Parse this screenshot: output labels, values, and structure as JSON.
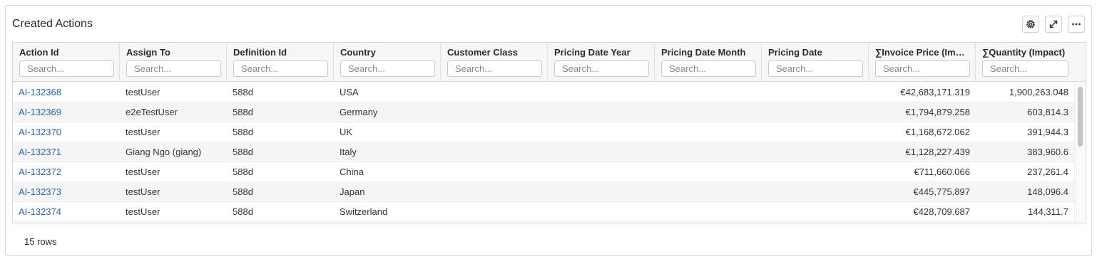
{
  "panel": {
    "title": "Created Actions",
    "tools": [
      {
        "icon": "gear-icon"
      },
      {
        "icon": "expand-icon"
      },
      {
        "icon": "more-icon"
      }
    ]
  },
  "table": {
    "columns": [
      {
        "label": "Action Id",
        "placeholder": "Search..."
      },
      {
        "label": "Assign To",
        "placeholder": "Search..."
      },
      {
        "label": "Definition Id",
        "placeholder": "Search..."
      },
      {
        "label": "Country",
        "placeholder": "Search..."
      },
      {
        "label": "Customer Class",
        "placeholder": "Search..."
      },
      {
        "label": "Pricing Date Year",
        "placeholder": "Search..."
      },
      {
        "label": "Pricing Date Month",
        "placeholder": "Search..."
      },
      {
        "label": "Pricing Date",
        "placeholder": "Search..."
      },
      {
        "label": "∑Invoice Price (Impact)",
        "placeholder": "Search..."
      },
      {
        "label": "∑Quantity (Impact)",
        "placeholder": "Search..."
      }
    ],
    "rows": [
      {
        "action_id": "AI-132368",
        "assign_to": "testUser",
        "definition_id": "588d",
        "country": "USA",
        "customer_class": "",
        "pricing_date_year": "",
        "pricing_date_month": "",
        "pricing_date": "",
        "invoice_price": "€42,683,171.319",
        "quantity": "1,900,263.048"
      },
      {
        "action_id": "AI-132369",
        "assign_to": "e2eTestUser",
        "definition_id": "588d",
        "country": "Germany",
        "customer_class": "",
        "pricing_date_year": "",
        "pricing_date_month": "",
        "pricing_date": "",
        "invoice_price": "€1,794,879.258",
        "quantity": "603,814.3"
      },
      {
        "action_id": "AI-132370",
        "assign_to": "testUser",
        "definition_id": "588d",
        "country": "UK",
        "customer_class": "",
        "pricing_date_year": "",
        "pricing_date_month": "",
        "pricing_date": "",
        "invoice_price": "€1,168,672.062",
        "quantity": "391,944.3"
      },
      {
        "action_id": "AI-132371",
        "assign_to": "Giang Ngo (giang)",
        "definition_id": "588d",
        "country": "Italy",
        "customer_class": "",
        "pricing_date_year": "",
        "pricing_date_month": "",
        "pricing_date": "",
        "invoice_price": "€1,128,227.439",
        "quantity": "383,960.6"
      },
      {
        "action_id": "AI-132372",
        "assign_to": "testUser",
        "definition_id": "588d",
        "country": "China",
        "customer_class": "",
        "pricing_date_year": "",
        "pricing_date_month": "",
        "pricing_date": "",
        "invoice_price": "€711,660.066",
        "quantity": "237,261.4"
      },
      {
        "action_id": "AI-132373",
        "assign_to": "testUser",
        "definition_id": "588d",
        "country": "Japan",
        "customer_class": "",
        "pricing_date_year": "",
        "pricing_date_month": "",
        "pricing_date": "",
        "invoice_price": "€445,775.897",
        "quantity": "148,096.4"
      },
      {
        "action_id": "AI-132374",
        "assign_to": "testUser",
        "definition_id": "588d",
        "country": "Switzerland",
        "customer_class": "",
        "pricing_date_year": "",
        "pricing_date_month": "",
        "pricing_date": "",
        "invoice_price": "€428,709.687",
        "quantity": "144,311.7"
      }
    ],
    "footer": "15 rows"
  }
}
